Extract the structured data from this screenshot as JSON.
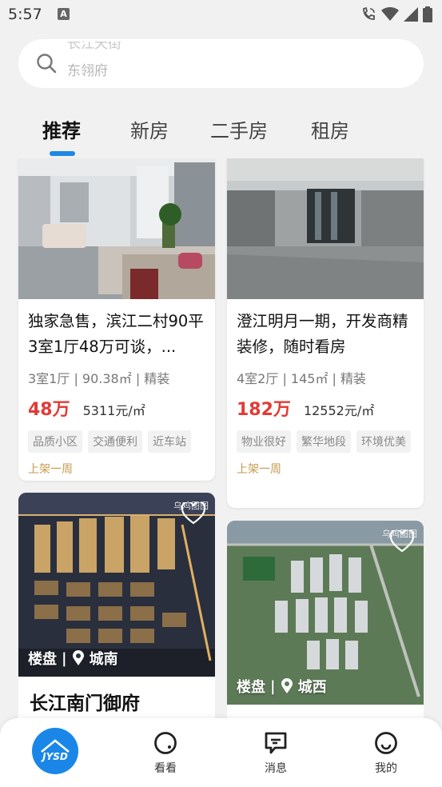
{
  "status_bar": {
    "time": "5:57",
    "notification_letter": "A",
    "icons": [
      "wifi-calling-icon",
      "wifi-icon",
      "signal-icon",
      "battery-icon"
    ]
  },
  "search": {
    "placeholder_line1": "长江天街",
    "placeholder_line2": "东翎府"
  },
  "tabs": [
    {
      "label": "推荐",
      "active": true
    },
    {
      "label": "新房",
      "active": false
    },
    {
      "label": "二手房",
      "active": false
    },
    {
      "label": "租房",
      "active": false
    }
  ],
  "listings": [
    {
      "title": "独家急售，滨江二村90平3室1厅48万可谈，...",
      "spec": "3室1厅 | 90.38㎡ | 精装",
      "price": "48万",
      "unit_price": "5311元/㎡",
      "tags": [
        "品质小区",
        "交通便利",
        "近车站"
      ],
      "listed": "上架一周"
    },
    {
      "title": "澄江明月一期，开发商精装修，随时看房",
      "spec": "4室2厅 | 145㎡ | 精装",
      "price": "182万",
      "unit_price": "12552元/㎡",
      "tags": [
        "物业很好",
        "繁华地段",
        "环境优美"
      ],
      "listed": "上架一周"
    }
  ],
  "projects": [
    {
      "type": "楼盘",
      "area": "城南",
      "name": "长江南门御府",
      "watermark": "乌鸡图图"
    },
    {
      "type": "楼盘",
      "area": "城西",
      "name": "",
      "watermark": "乌鸡图图"
    }
  ],
  "bottom_nav": {
    "logo_text": "JYSD",
    "items": [
      {
        "label": "看看",
        "icon": "look-icon"
      },
      {
        "label": "消息",
        "icon": "message-icon"
      },
      {
        "label": "我的",
        "icon": "profile-icon"
      }
    ]
  },
  "colors": {
    "accent": "#1e88e5",
    "price": "#e23b36",
    "listed": "#c69a4f",
    "background": "#f1f1f1"
  }
}
